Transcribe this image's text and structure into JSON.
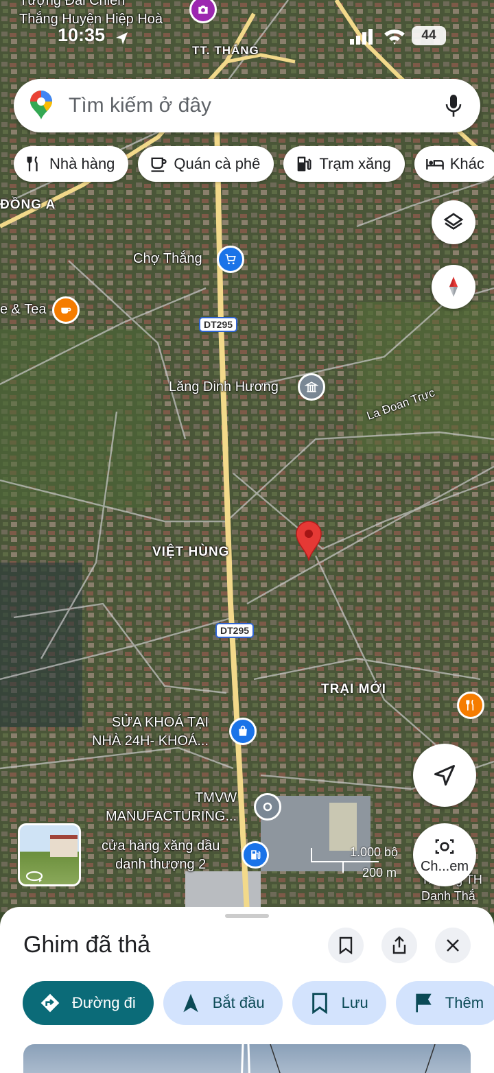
{
  "status_bar": {
    "time": "10:35",
    "battery": "44"
  },
  "search": {
    "placeholder": "Tìm kiếm ở đây"
  },
  "chips": [
    {
      "label": "Nhà hàng",
      "icon": "fork-knife-icon"
    },
    {
      "label": "Quán cà phê",
      "icon": "coffee-icon"
    },
    {
      "label": "Trạm xăng",
      "icon": "gas-pump-icon"
    },
    {
      "label": "Khác",
      "icon": "bed-icon"
    }
  ],
  "map": {
    "labels": {
      "top_poi": "Tượng Đài Chiến\nThắng Huyện Hiệp Hoà",
      "tt_thang": "TT. THẮNG",
      "dong_a": "ĐỒNG A",
      "cho_thang": "Chợ Thắng",
      "tea": "e & Tea",
      "lang": "Lăng Dinh Hương",
      "la_doan_truc": "La Đoan Trực",
      "viet_hung": "VIỆT HÙNG",
      "trai_moi": "TRẠI MỚI",
      "sua_khoa": "SỬA KHOÁ TẠI\nNHÀ 24H- KHOÁ...",
      "tmvw": "TMVW\nMANUFACTURING...",
      "cua_hang": "cửa hàng xăng dầu\ndanh thượng 2",
      "truong": "Trường TH\nDanh Thắ"
    },
    "road_shields": [
      "DT295",
      "DT295"
    ],
    "scale": {
      "imperial": "1.000 bộ",
      "metric": "200 m"
    },
    "compass_label": "Ch...em",
    "colors": {
      "pin": "#e53935",
      "road_yellow": "#f2d98a",
      "poi_orange": "#f57c00",
      "poi_blue": "#1a73e8",
      "poi_gray": "#7a8794"
    }
  },
  "sheet": {
    "title": "Ghim đã thả",
    "actions": [
      {
        "label": "Đường đi",
        "icon": "directions-icon"
      },
      {
        "label": "Bắt đầu",
        "icon": "navigation-arrow-icon"
      },
      {
        "label": "Lưu",
        "icon": "bookmark-icon"
      },
      {
        "label": "Thêm",
        "icon": "flag-icon"
      }
    ]
  }
}
